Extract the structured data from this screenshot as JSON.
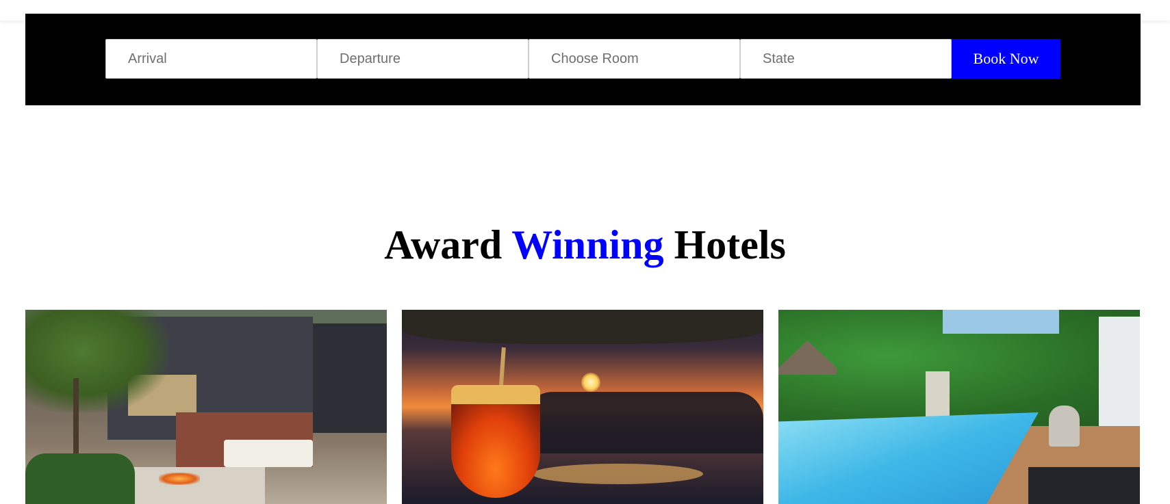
{
  "booking": {
    "arrival_placeholder": "Arrival",
    "departure_placeholder": "Departure",
    "room_placeholder": "Choose Room",
    "state_placeholder": "State",
    "book_label": "Book Now"
  },
  "section": {
    "title_part1": "Award",
    "title_accent": "Winning",
    "title_part2": "Hotels"
  },
  "colors": {
    "accent": "#0000ff",
    "bar_background": "#000000"
  }
}
